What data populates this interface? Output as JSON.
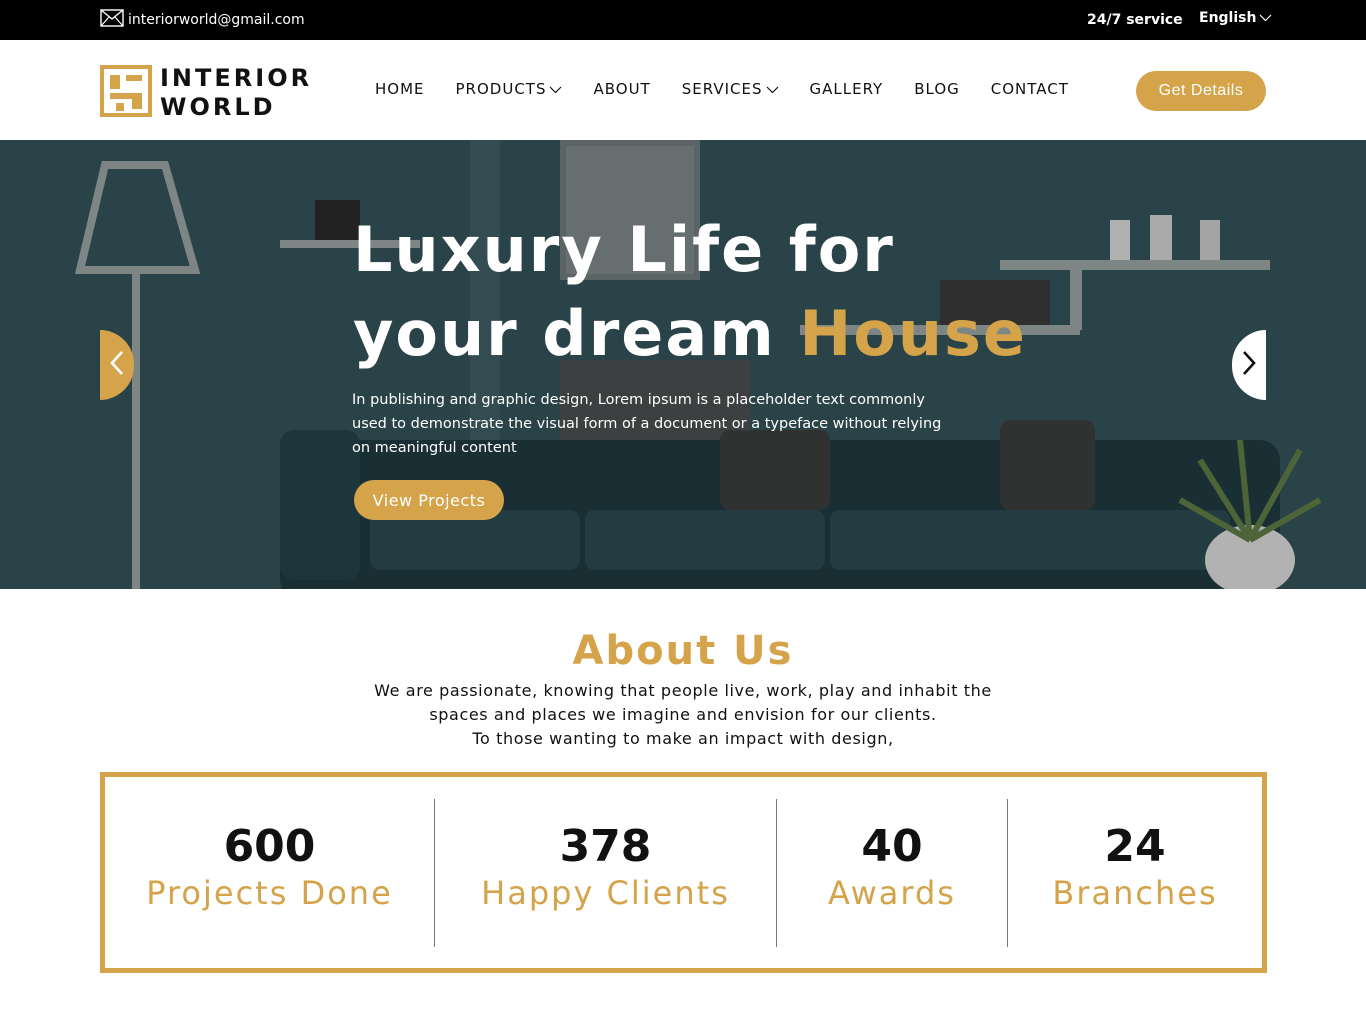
{
  "topbar": {
    "email": "interiorworld@gmail.com",
    "service": "24/7 service",
    "language": "English",
    "icons": [
      "mail-icon",
      "chevron-down-icon"
    ]
  },
  "header": {
    "logo": {
      "line1": "INTERIOR",
      "line2": "WORLD"
    },
    "nav": [
      {
        "label": "HOME",
        "dropdown": false
      },
      {
        "label": "PRODUCTS",
        "dropdown": true
      },
      {
        "label": "ABOUT",
        "dropdown": false
      },
      {
        "label": "SERVICES",
        "dropdown": true
      },
      {
        "label": "GALLERY",
        "dropdown": false
      },
      {
        "label": "BLOG",
        "dropdown": false
      },
      {
        "label": "CONTACT",
        "dropdown": false
      }
    ],
    "cta": "Get Details"
  },
  "hero": {
    "title_line1": "Luxury Life for",
    "title_line2_prefix": "your dream ",
    "title_line2_accent": "House",
    "description": "In publishing and graphic design, Lorem ipsum is a placeholder text commonly used to demonstrate the visual form of a document or a typeface without relying on meaningful content",
    "button": "View Projects"
  },
  "about": {
    "title": "About Us",
    "lines": [
      "We are passionate, knowing that people live, work, play and inhabit the",
      "spaces and places we imagine and envision for our clients.",
      "To those wanting to make an impact with design,"
    ]
  },
  "stats": [
    {
      "value": "600",
      "label": "Projects Done"
    },
    {
      "value": "378",
      "label": "Happy Clients"
    },
    {
      "value": "40",
      "label": "Awards"
    },
    {
      "value": "24",
      "label": "Branches"
    }
  ],
  "colors": {
    "accent": "#d4a34a",
    "topbar": "#000000",
    "hero_base": "#2f4a50"
  }
}
